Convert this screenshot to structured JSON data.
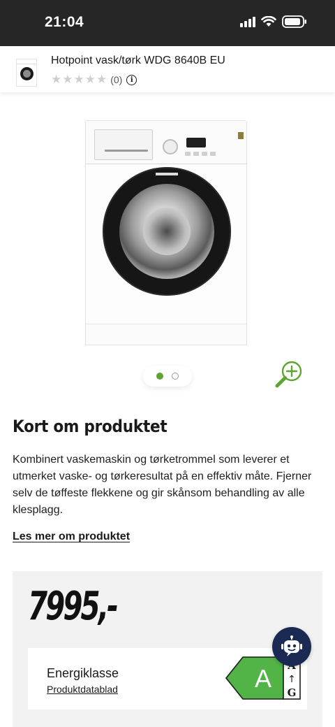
{
  "status_bar": {
    "time": "21:04"
  },
  "product_header": {
    "title": "Hotpoint vask/tørk WDG 8640B EU",
    "stars": "★★★★★",
    "review_count": "(0)",
    "info_glyph": "i",
    "rating_value": 0,
    "rating_max": 5
  },
  "gallery": {
    "image_count": 2,
    "active_index": 0,
    "zoom_icon": "zoom-in-icon"
  },
  "summary": {
    "heading": "Kort om produktet",
    "text": "Kombinert vaskemaskin og tørketrommel som leverer et utmerket vaske- og tørkeresultat på en effektiv måte. Fjerner selv de tøffeste flekkene og gir skånsom behandling av alle klesplagg.",
    "read_more": "Les mer om produktet"
  },
  "price_box": {
    "price": "7995,-",
    "energy_label": "Energiklasse",
    "datasheet_link": "Produktdatablad",
    "energy_class": "A",
    "scale_top": "A",
    "scale_arrow": "↑",
    "scale_bottom": "G"
  },
  "colors": {
    "accent_green": "#5ea52f",
    "energy_green": "#52b447",
    "chatbot_bg": "#1a2a52",
    "status_bar_bg": "#262626"
  }
}
